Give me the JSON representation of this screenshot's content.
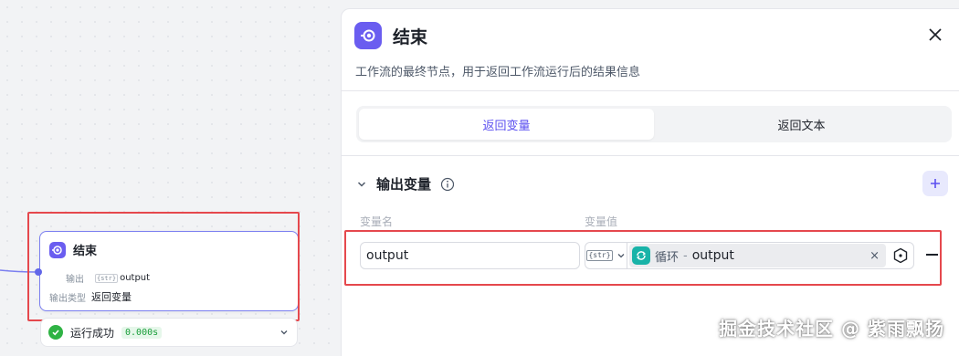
{
  "canvas": {
    "node": {
      "title": "结束",
      "output_label": "输出",
      "output_type_tag": "{str}",
      "output_value": "output",
      "output_type_label": "输出类型",
      "output_type_value": "返回变量",
      "icon": "end-node-icon"
    },
    "run_status": {
      "text": "运行成功",
      "time": "0.000s",
      "icon": "check-circle-icon"
    }
  },
  "panel": {
    "title": "结束",
    "description": "工作流的最终节点，用于返回工作流运行后的结果信息",
    "tabs": [
      {
        "label": "返回变量",
        "active": true
      },
      {
        "label": "返回文本",
        "active": false
      }
    ],
    "section": {
      "title": "输出变量",
      "columns": {
        "name": "变量名",
        "value": "变量值"
      },
      "rows": [
        {
          "name": "output",
          "type_tag": "{str}",
          "ref_source": "循环",
          "ref_separator": "-",
          "ref_var": "output"
        }
      ]
    }
  },
  "watermark": "掘金技术社区 @ 紫雨飘扬",
  "colors": {
    "accent": "#5b4ff0",
    "node_icon": "#6a5df0",
    "loop_icon": "#19b3a8",
    "success": "#2fb344",
    "highlight_box": "#e5484d"
  }
}
